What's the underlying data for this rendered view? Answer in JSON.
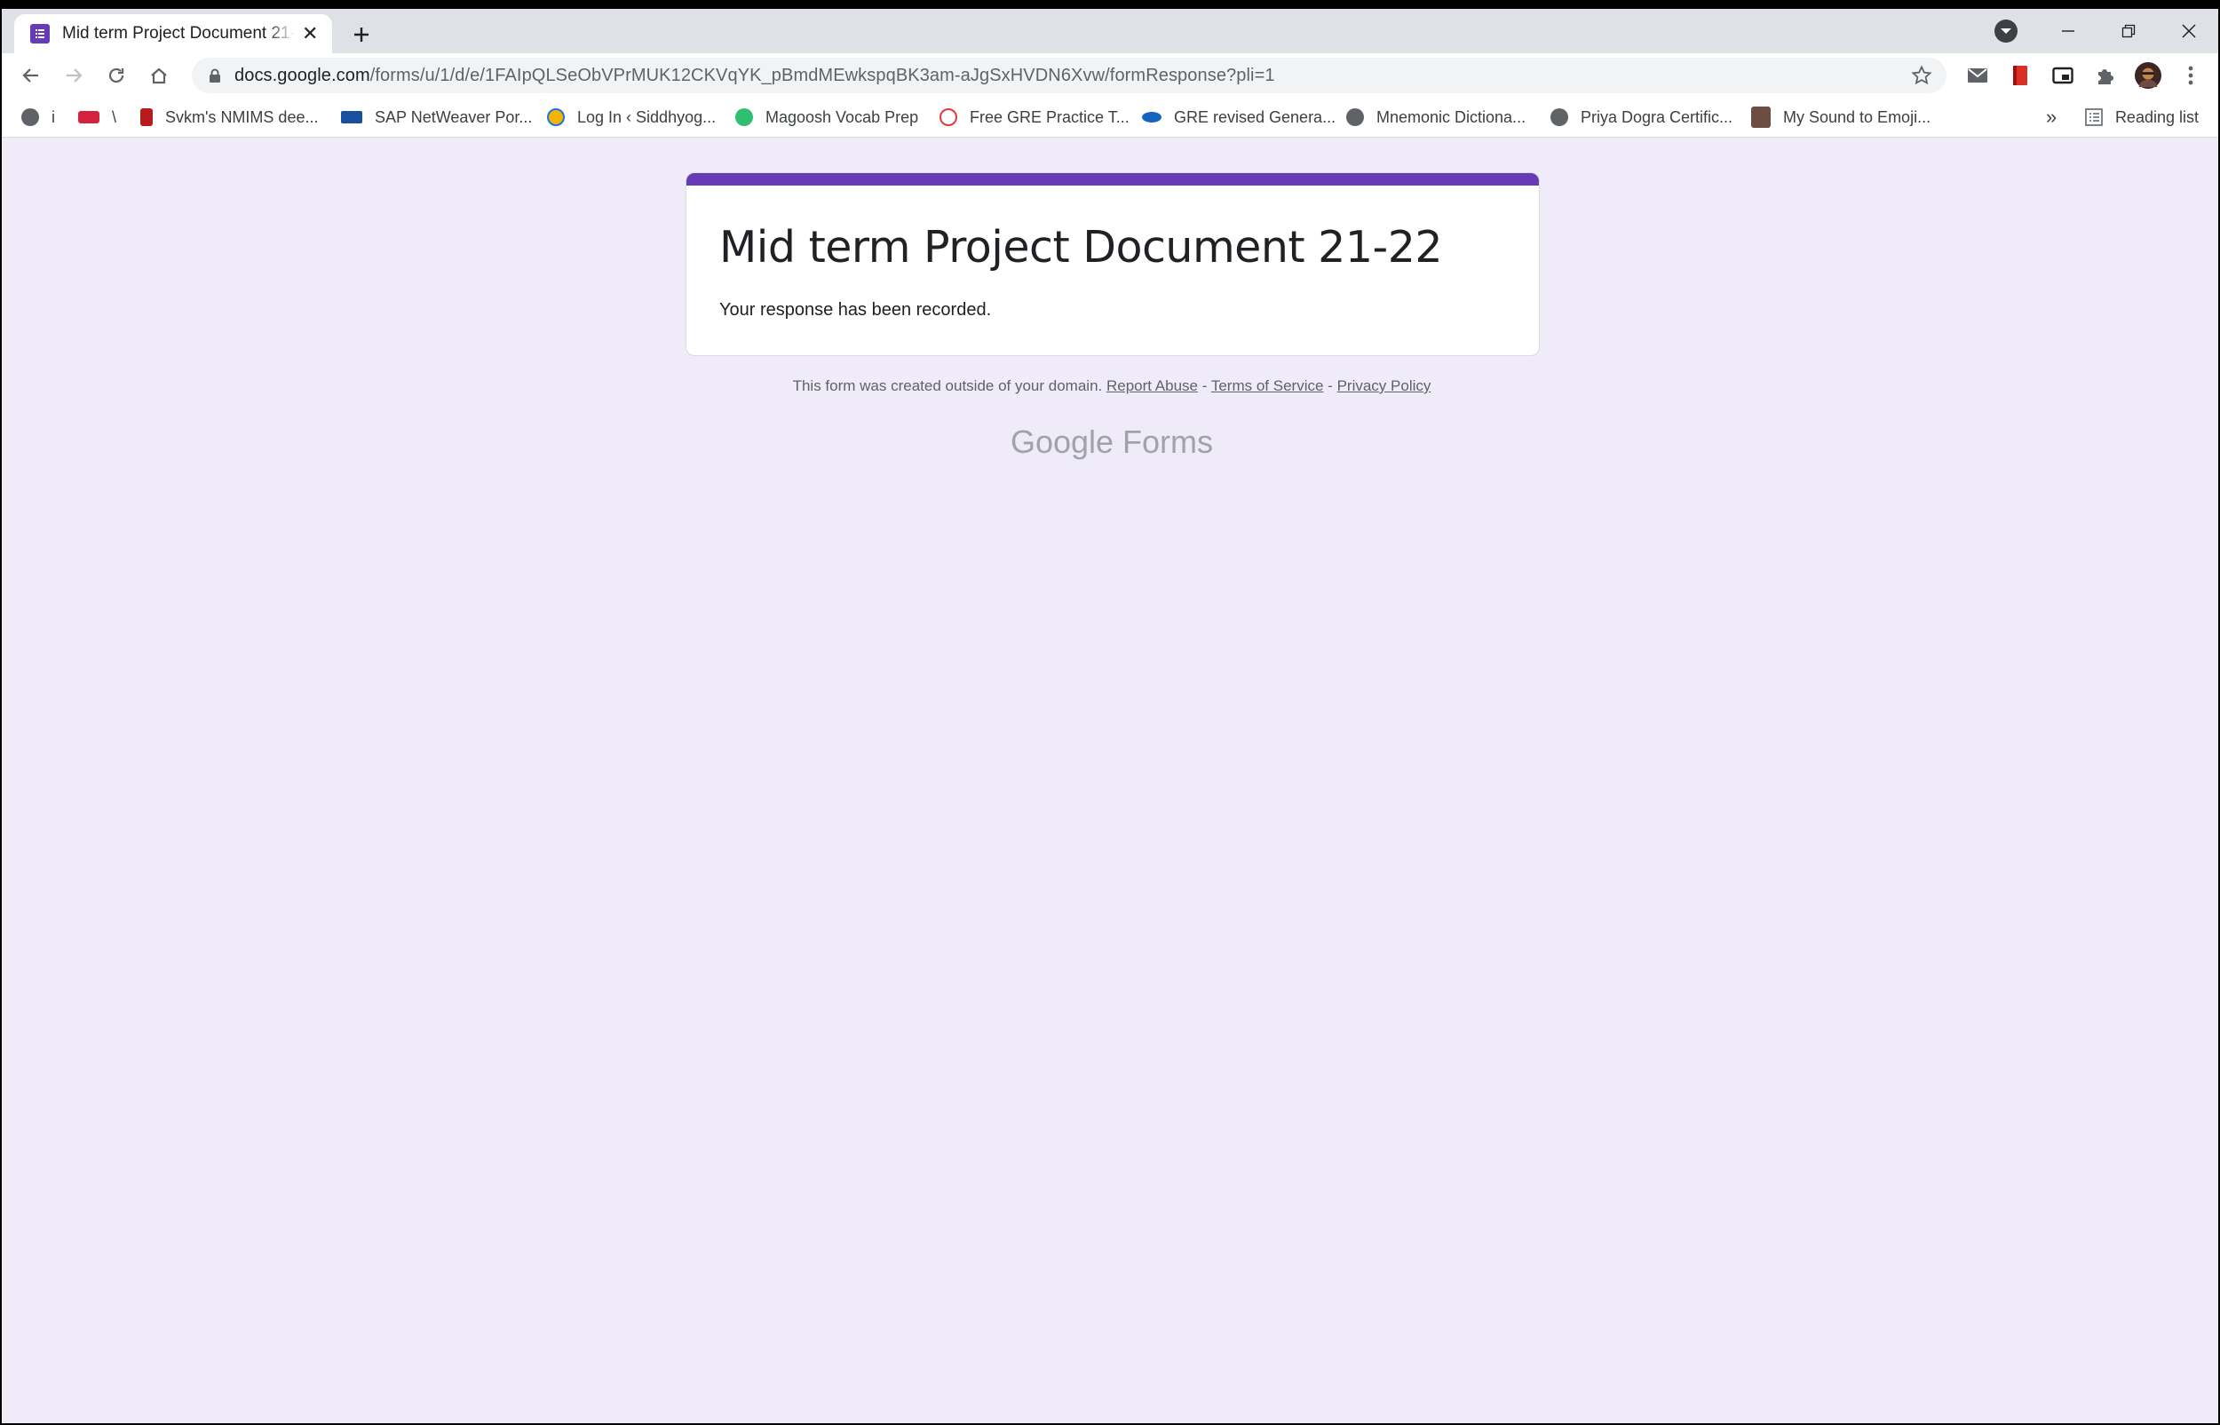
{
  "tab": {
    "title": "Mid term Project Document 21-22"
  },
  "address_bar": {
    "domain": "docs.google.com",
    "path": "/forms/u/1/d/e/1FAIpQLSeObVPrMUK12CKVqYK_pBmdMEwkspqBK3am-aJgSxHVDN6Xvw/formResponse?pli=1"
  },
  "bookmarks": {
    "items": [
      {
        "label": "i",
        "icon": "globe-icon",
        "color": "#5f6368"
      },
      {
        "label": "\\",
        "icon": "edx-icon",
        "color": "#d4213d"
      },
      {
        "label": "Svkm's NMIMS dee...",
        "icon": "nmims-icon",
        "color": "#b71c1c"
      },
      {
        "label": "SAP NetWeaver Por...",
        "icon": "sap-icon",
        "color": "#1a4fa0"
      },
      {
        "label": "Log In ‹ Siddhyog...",
        "icon": "wordpress-icon",
        "color": "#f6b400"
      },
      {
        "label": "Magoosh Vocab Prep",
        "icon": "magoosh-icon",
        "color": "#2fbf71"
      },
      {
        "label": "Free GRE Practice T...",
        "icon": "gre-practice-icon",
        "color": "#e53935"
      },
      {
        "label": "GRE revised Genera...",
        "icon": "ets-icon",
        "color": "#1565c0"
      },
      {
        "label": "Mnemonic Dictiona...",
        "icon": "globe-icon",
        "color": "#5f6368"
      },
      {
        "label": "Priya Dogra Certific...",
        "icon": "globe-icon",
        "color": "#5f6368"
      },
      {
        "label": "My Sound to Emoji...",
        "icon": "person-icon",
        "color": "#6d4c41"
      }
    ],
    "overflow": "»",
    "reading_list": "Reading list"
  },
  "form": {
    "title": "Mid term Project Document 21-22",
    "confirmation": "Your response has been recorded.",
    "accent_color": "#673ab7"
  },
  "footer": {
    "note": "This form was created outside of your domain.",
    "report_abuse": "Report Abuse",
    "terms": "Terms of Service",
    "privacy": "Privacy Policy",
    "separator": "-",
    "brand_google": "Google",
    "brand_forms": "Forms"
  }
}
